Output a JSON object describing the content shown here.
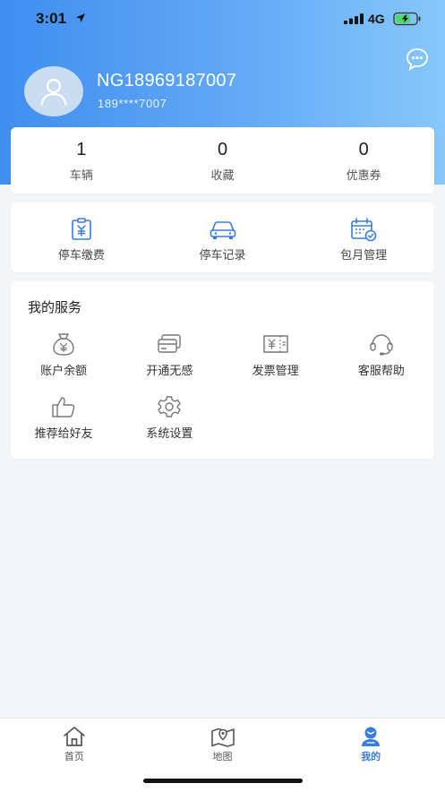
{
  "status_bar": {
    "time": "3:01",
    "network": "4G"
  },
  "profile": {
    "username": "NG18969187007",
    "phone": "189****7007"
  },
  "stats": [
    {
      "value": "1",
      "label": "车辆"
    },
    {
      "value": "0",
      "label": "收藏"
    },
    {
      "value": "0",
      "label": "优惠券"
    }
  ],
  "quick_actions": [
    {
      "label": "停车缴费",
      "icon": "parking-fee-icon"
    },
    {
      "label": "停车记录",
      "icon": "car-icon"
    },
    {
      "label": "包月管理",
      "icon": "calendar-icon"
    }
  ],
  "services": {
    "title": "我的服务",
    "items": [
      {
        "label": "账户余额",
        "icon": "money-bag-icon"
      },
      {
        "label": "开通无感",
        "icon": "card-icon"
      },
      {
        "label": "发票管理",
        "icon": "invoice-icon"
      },
      {
        "label": "客服帮助",
        "icon": "headset-icon"
      },
      {
        "label": "推荐给好友",
        "icon": "thumbs-up-icon"
      },
      {
        "label": "系统设置",
        "icon": "gear-icon"
      }
    ]
  },
  "tabbar": {
    "items": [
      {
        "label": "首页",
        "icon": "home-icon"
      },
      {
        "label": "地图",
        "icon": "map-icon"
      },
      {
        "label": "我的",
        "icon": "user-icon"
      }
    ],
    "active": "我的"
  },
  "colors": {
    "accent": "#3a7be0",
    "header_start": "#3f8ef0",
    "header_end": "#86c8fb",
    "icon_stroke": "#3a7be0"
  }
}
